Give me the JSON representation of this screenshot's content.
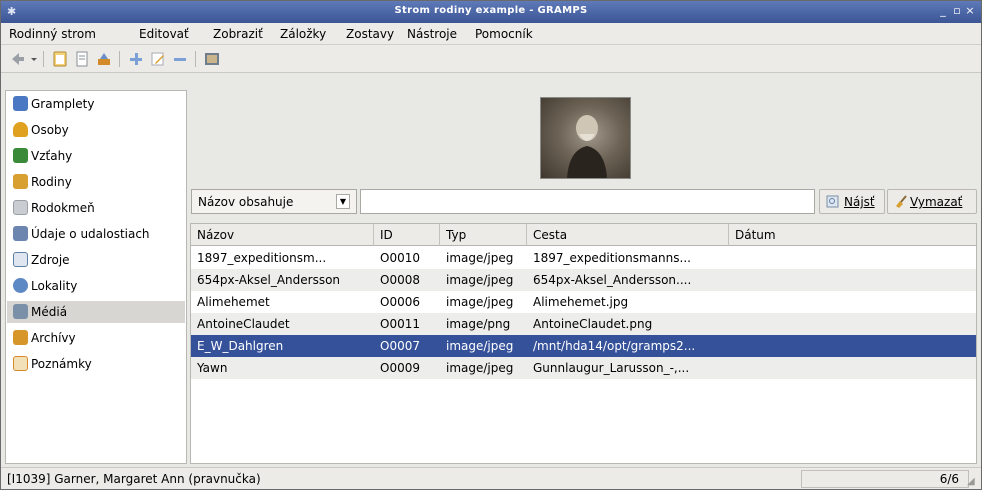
{
  "window": {
    "title": "Strom rodiny example - GRAMPS",
    "min": "_",
    "max": "▫",
    "close": "×"
  },
  "menu": [
    "Rodinný strom",
    "Editovať",
    "Zobraziť",
    "Záložky",
    "Zostavy",
    "Nástroje",
    "Pomocník"
  ],
  "sidebar": {
    "items": [
      {
        "label": "Gramplety",
        "icon": "gramplets-icon",
        "color": "#4a78c2"
      },
      {
        "label": "Osoby",
        "icon": "person-icon",
        "color": "#e0a020"
      },
      {
        "label": "Vzťahy",
        "icon": "relationships-icon",
        "color": "#3a8a3a"
      },
      {
        "label": "Rodiny",
        "icon": "family-icon",
        "color": "#d7a030"
      },
      {
        "label": "Rodokmeň",
        "icon": "pedigree-icon",
        "color": "#9aa0a6"
      },
      {
        "label": "Údaje o udalostiach",
        "icon": "events-icon",
        "color": "#6d86b0"
      },
      {
        "label": "Zdroje",
        "icon": "sources-icon",
        "color": "#5e7fa8"
      },
      {
        "label": "Lokality",
        "icon": "places-icon",
        "color": "#5c88c4"
      },
      {
        "label": "Médiá",
        "icon": "media-icon",
        "color": "#7a8fa8"
      },
      {
        "label": "Archívy",
        "icon": "repositories-icon",
        "color": "#d6962a"
      },
      {
        "label": "Poznámky",
        "icon": "notes-icon",
        "color": "#d88a2a"
      }
    ],
    "selected": "Médiá"
  },
  "filter": {
    "combo_value": "Názov obsahuje",
    "search_value": "",
    "find_label": "Nájsť",
    "clear_label": "Vymazať"
  },
  "table": {
    "columns": [
      "Názov",
      "ID",
      "Typ",
      "Cesta",
      "Dátum"
    ],
    "rows": [
      {
        "name": "1897_expeditionsm...",
        "id": "O0010",
        "type": "image/jpeg",
        "path": "1897_expeditionsmanns...",
        "date": ""
      },
      {
        "name": "654px-Aksel_Andersson",
        "id": "O0008",
        "type": "image/jpeg",
        "path": "654px-Aksel_Andersson....",
        "date": ""
      },
      {
        "name": "Alimehemet",
        "id": "O0006",
        "type": "image/jpeg",
        "path": "Alimehemet.jpg",
        "date": ""
      },
      {
        "name": "AntoineClaudet",
        "id": "O0011",
        "type": "image/png",
        "path": "AntoineClaudet.png",
        "date": ""
      },
      {
        "name": "E_W_Dahlgren",
        "id": "O0007",
        "type": "image/jpeg",
        "path": "/mnt/hda14/opt/gramps2...",
        "date": ""
      },
      {
        "name": "Yawn",
        "id": "O0009",
        "type": "image/jpeg",
        "path": "Gunnlaugur_Larusson_-,...",
        "date": ""
      }
    ],
    "selected_index": 4
  },
  "status": {
    "text": "[I1039] Garner, Margaret Ann (pravnučka)",
    "count": "6/6"
  },
  "colors": {
    "title_bar": "#3b5595",
    "selection": "#34519a"
  }
}
